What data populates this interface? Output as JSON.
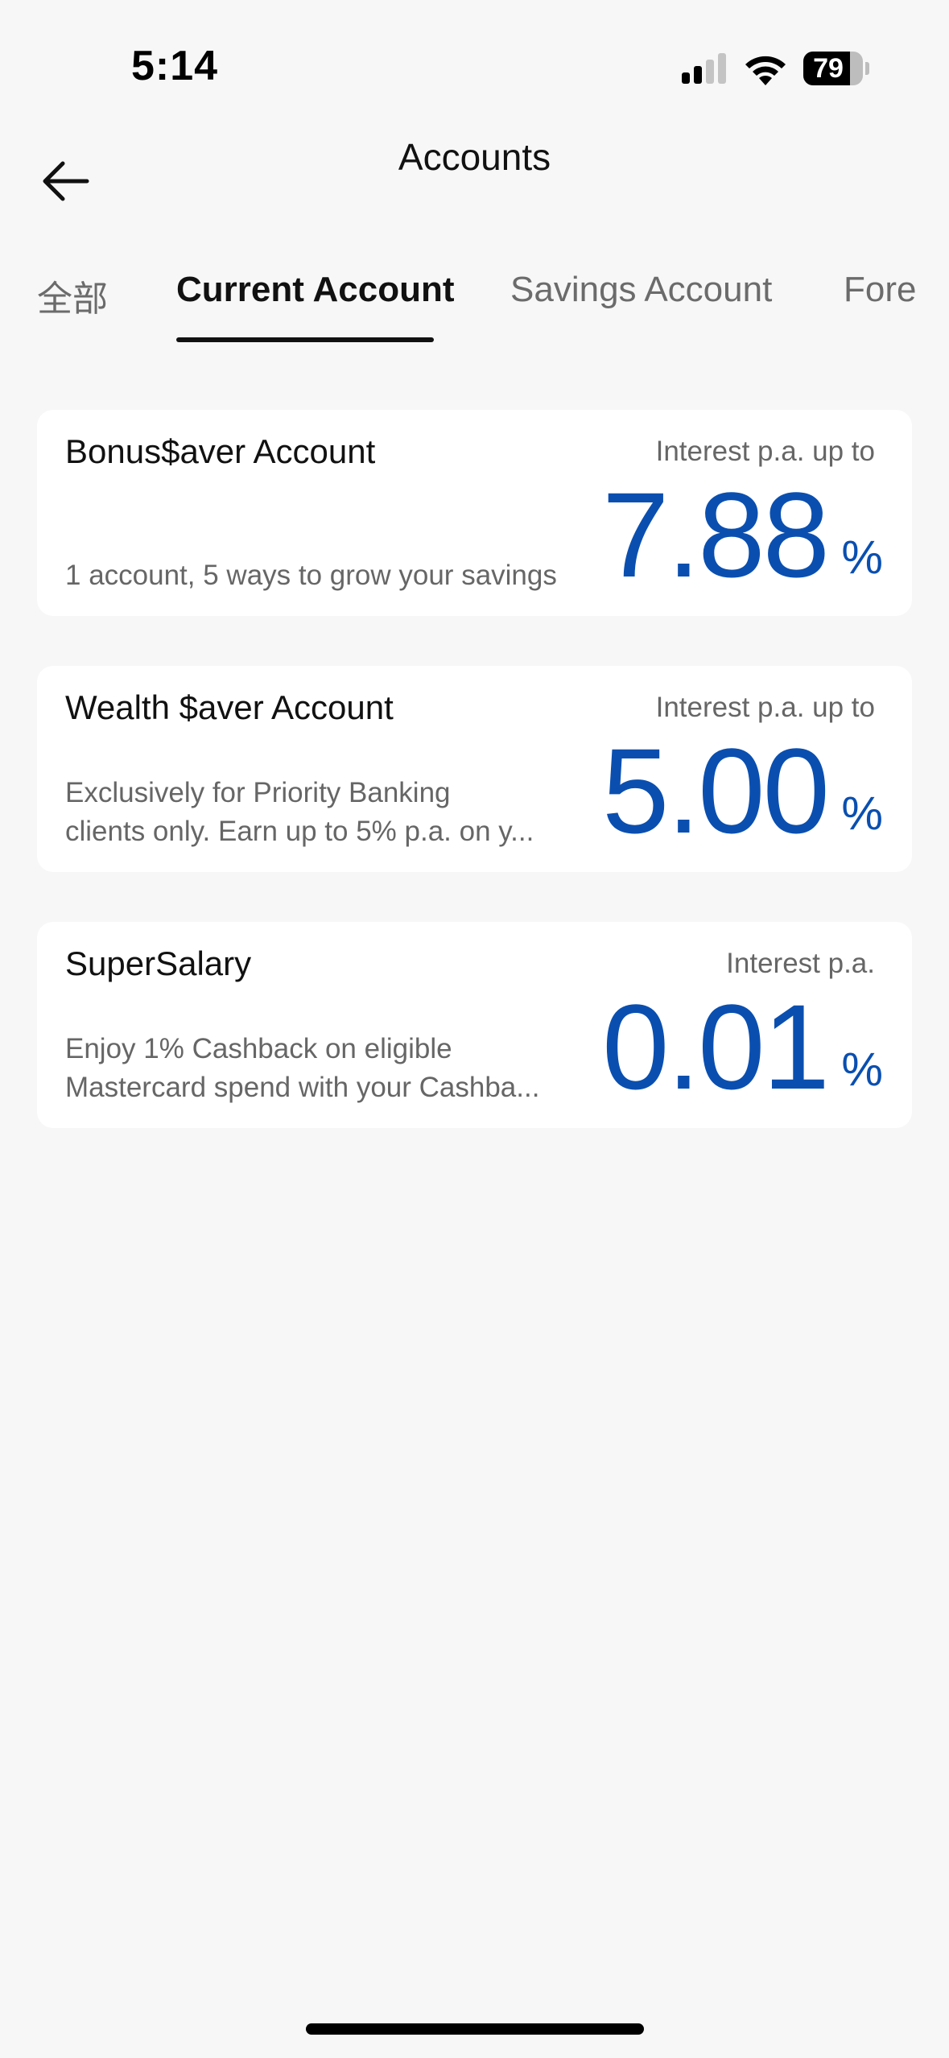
{
  "status_bar": {
    "time": "5:14",
    "battery_level": "79",
    "battery_fraction": 0.79,
    "icons": [
      "signal-icon",
      "wifi-icon",
      "battery-icon"
    ]
  },
  "header": {
    "title": "Accounts",
    "back_icon": "arrow-left-icon"
  },
  "tabs": [
    {
      "label": "全部",
      "active": false
    },
    {
      "label": "Current Account",
      "active": true
    },
    {
      "label": "Savings Account",
      "active": false
    },
    {
      "label": "Fore",
      "active": false
    }
  ],
  "accounts": [
    {
      "name": "Bonus$aver Account",
      "description_lines": [
        "1 account, 5 ways to grow your savings"
      ],
      "rate_label": "Interest p.a. up to",
      "rate": "7.88",
      "unit": "%"
    },
    {
      "name": "Wealth $aver Account",
      "description_lines": [
        "Exclusively for Priority Banking",
        "clients only.  Earn up to 5% p.a. on y..."
      ],
      "rate_label": "Interest p.a. up to",
      "rate": "5.00",
      "unit": "%"
    },
    {
      "name": "SuperSalary",
      "description_lines": [
        "Enjoy 1% Cashback on eligible",
        "Mastercard spend with your Cashba..."
      ],
      "rate_label": "Interest p.a.",
      "rate": "0.01",
      "unit": "%"
    }
  ],
  "colors": {
    "background": "#f7f7f7",
    "card": "#ffffff",
    "accent_blue": "#0a4fb0",
    "text_primary": "#111111",
    "text_secondary": "#666666"
  }
}
